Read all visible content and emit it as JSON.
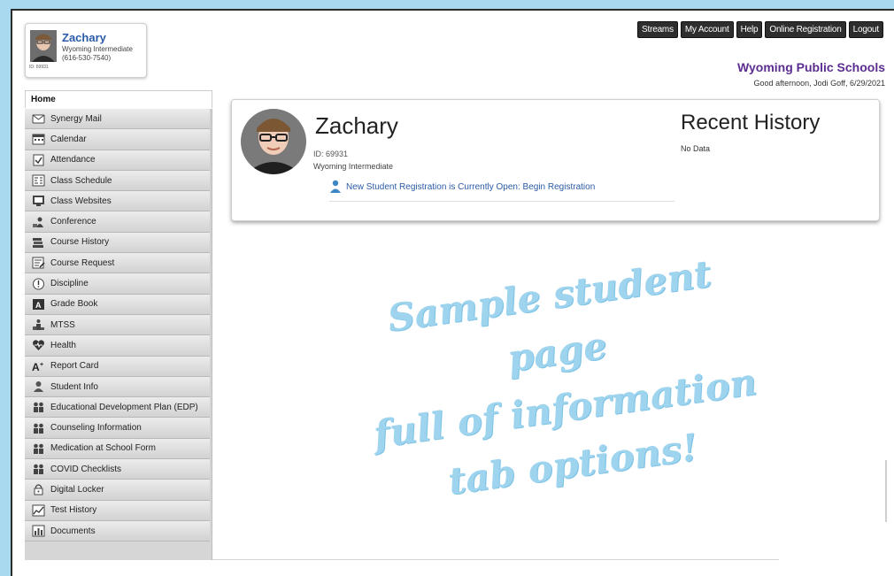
{
  "student_card": {
    "name": "Zachary",
    "school": "Wyoming Intermediate",
    "phone": "(616-530-7540)",
    "id_label": "ID: 69931"
  },
  "top_nav": [
    {
      "label": "Streams"
    },
    {
      "label": "My Account"
    },
    {
      "label": "Help"
    },
    {
      "label": "Online Registration"
    },
    {
      "label": "Logout"
    }
  ],
  "district_name": "Wyoming Public Schools",
  "greeting": "Good afternoon, Jodi Goff, 6/29/2021",
  "home_tab": "Home",
  "sidebar": {
    "items": [
      {
        "label": "Synergy Mail",
        "icon": "mail-icon"
      },
      {
        "label": "Calendar",
        "icon": "calendar-icon"
      },
      {
        "label": "Attendance",
        "icon": "checkbox-icon"
      },
      {
        "label": "Class Schedule",
        "icon": "schedule-icon"
      },
      {
        "label": "Class Websites",
        "icon": "website-icon"
      },
      {
        "label": "Conference",
        "icon": "conference-icon"
      },
      {
        "label": "Course History",
        "icon": "books-icon"
      },
      {
        "label": "Course Request",
        "icon": "request-icon"
      },
      {
        "label": "Discipline",
        "icon": "exclamation-icon"
      },
      {
        "label": "Grade Book",
        "icon": "gradebook-icon"
      },
      {
        "label": "MTSS",
        "icon": "podium-icon"
      },
      {
        "label": "Health",
        "icon": "heart-icon"
      },
      {
        "label": "Report Card",
        "icon": "grade-letter-icon"
      },
      {
        "label": "Student Info",
        "icon": "person-icon"
      },
      {
        "label": "Educational Development Plan (EDP)",
        "icon": "group-icon"
      },
      {
        "label": "Counseling Information",
        "icon": "group-icon"
      },
      {
        "label": "Medication at School Form",
        "icon": "group-icon"
      },
      {
        "label": "COVID Checklists",
        "icon": "group-icon"
      },
      {
        "label": "Digital Locker",
        "icon": "lock-icon"
      },
      {
        "label": "Test History",
        "icon": "chart-icon"
      },
      {
        "label": "Documents",
        "icon": "documents-icon"
      }
    ]
  },
  "main": {
    "name": "Zachary",
    "id": "ID: 69931",
    "school": "Wyoming Intermediate",
    "registration_link": "New Student Registration is Currently Open: Begin Registration",
    "recent_history_title": "Recent History",
    "recent_history_data": "No Data"
  },
  "overlay": {
    "line1": "Sample student page",
    "line2": "full of information",
    "line3": "tab options!"
  },
  "colors": {
    "background": "#a9d9ee",
    "link": "#2a5ba8",
    "district": "#5c2d91",
    "overlay": "#9fd4ee"
  }
}
